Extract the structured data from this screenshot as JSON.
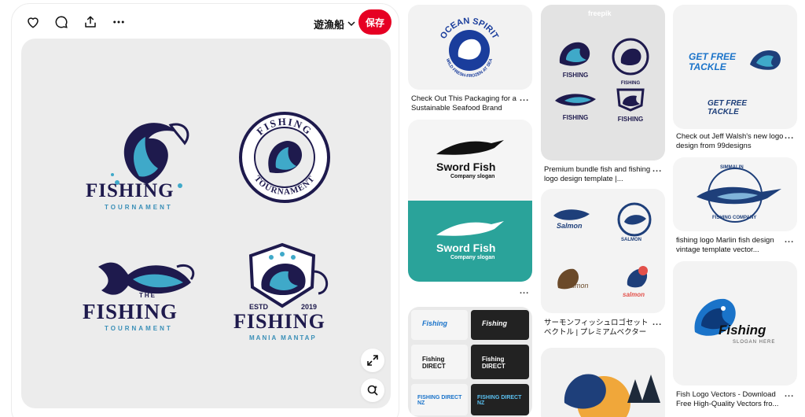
{
  "toolbar": {
    "like": "heart-icon",
    "comment": "speech-bubble-icon",
    "share": "share-icon",
    "more": "more-icon",
    "board_name": "遊漁船",
    "save_label": "保存"
  },
  "main_pin": {
    "logos": [
      {
        "word": "FISHING",
        "sub": "TOURNAMENT"
      },
      {
        "ring_top": "FISHING",
        "ring_bottom": "TOURNAMENT"
      },
      {
        "top": "THE",
        "word": "FISHING",
        "sub": "TOURNAMENT"
      },
      {
        "estd": "ESTD",
        "year": "2019",
        "word": "FISHING",
        "sub": "MANIA MANTAP"
      }
    ]
  },
  "grid": {
    "col1": [
      {
        "logo_text_top": "OCEAN SPIRIT",
        "logo_text_bottom": "WILD FRESH-FROZEN AT SEA",
        "caption": "Check Out This Packaging for a Sustainable Seafood Brand",
        "more": "..."
      },
      {
        "logo_word": "Sword Fish",
        "logo_slogan": "Company slogan",
        "logo_word_2": "Sword Fish",
        "logo_slogan_2": "Company slogan",
        "more": "..."
      },
      {
        "tiles": [
          "Fishing",
          "Fishing",
          "Fishing DIRECT",
          "Fishing DIRECT",
          "FISHING DIRECT NZ",
          "FISHING DIRECT NZ"
        ]
      }
    ],
    "col2": [
      {
        "watermark": "freepik",
        "labels": [
          "FISHING",
          "FISHING",
          "FISHING",
          "FISHING"
        ],
        "caption": "Premium bundle fish and fishing logo design template |...",
        "more": "..."
      },
      {
        "labels": [
          "Salmon",
          "SALMON",
          "Salmon",
          "salmon"
        ],
        "caption": "サーモンフィッシュロゴセット ベクトル | プレミアムベクター",
        "more": "..."
      },
      {
        "labels": []
      }
    ],
    "col3": [
      {
        "labels": [
          "GET FREE TACKLE",
          "GET FREE TACKLE"
        ],
        "caption": "Check out Jeff Walsh's new logo design from 99designs",
        "more": "..."
      },
      {
        "labels": [
          "SIMMALIN",
          "FISHING COMPANY"
        ],
        "caption": "fishing logo Marlin fish design vintage template vector...",
        "more": "..."
      },
      {
        "labels": [
          "Fishing",
          "SLOGAN HERE"
        ],
        "caption": "Fish Logo Vectors - Download Free High-Quality Vectors fro...",
        "more": "..."
      }
    ]
  },
  "colors": {
    "save": "#e60023",
    "navy": "#1e1a4d",
    "teal": "#2aa39a",
    "blue": "#1a73c9"
  }
}
